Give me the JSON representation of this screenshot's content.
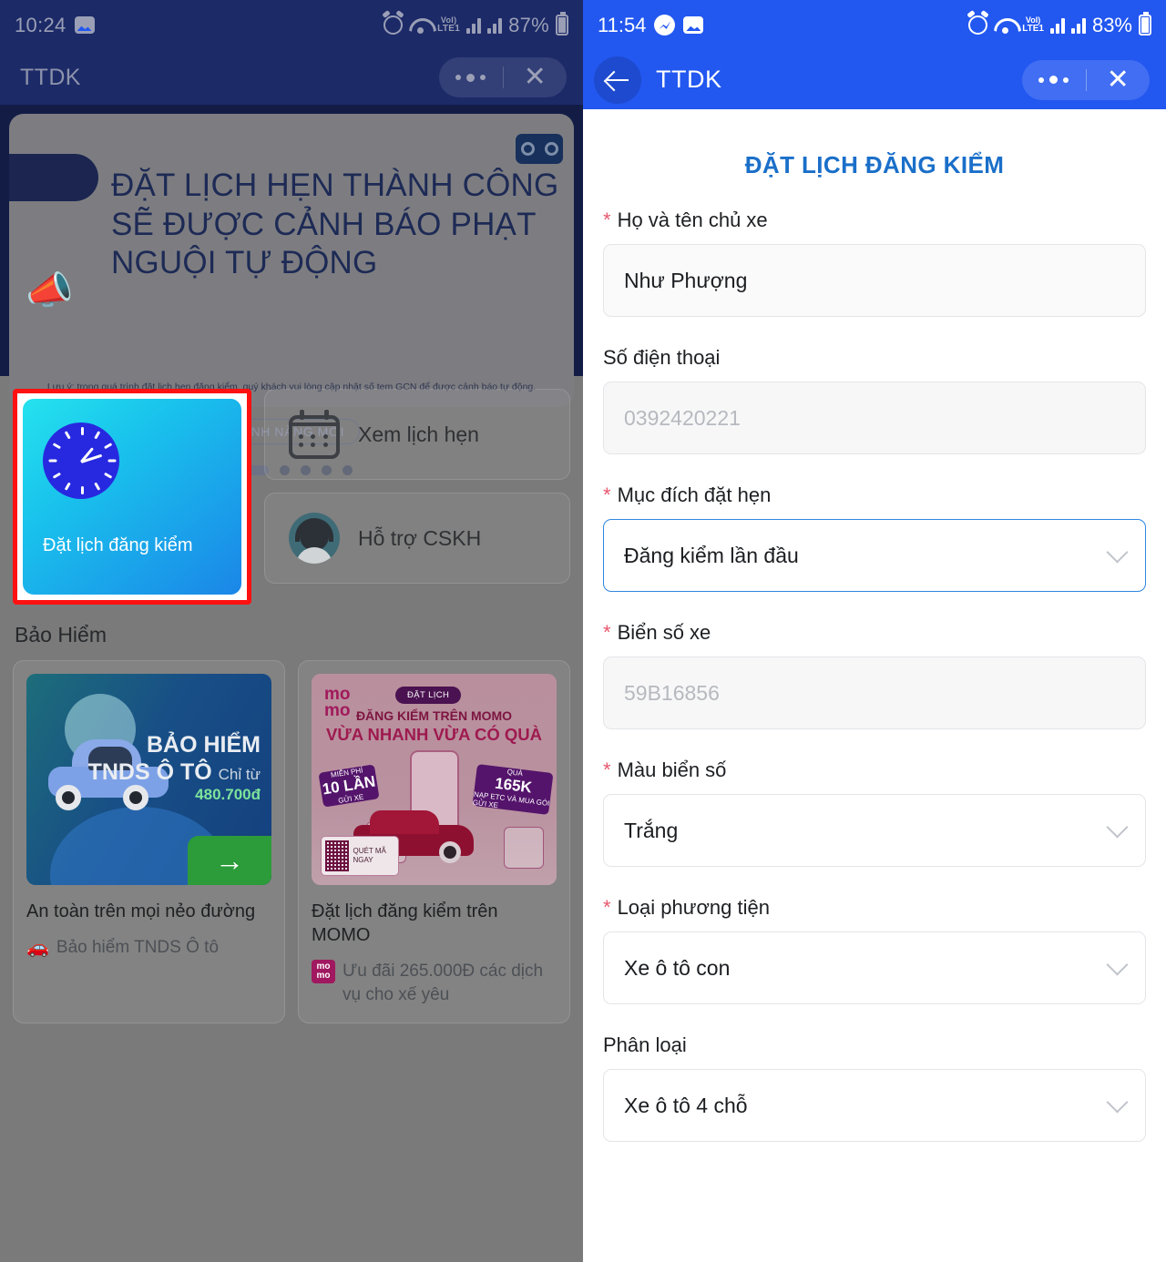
{
  "left": {
    "status": {
      "time": "10:24",
      "battery": "87%",
      "network": "LTE1",
      "volte": "VoI)"
    },
    "appbar": {
      "title": "TTDK"
    },
    "banner": {
      "title": "ĐẶT LỊCH HẸN THÀNH CÔNG SẼ ĐƯỢC CẢNH BÁO PHẠT NGUỘI TỰ ĐỘNG",
      "note": "Lưu ý: trong quá trình đặt lịch hẹn đăng kiểm, quý khách vui lòng cập nhật số tem GCN để được cảnh báo tự động.",
      "feature_chip": "TÍNH NĂNG MỚI",
      "dots_count": 5,
      "active_dot": 0
    },
    "tiles": {
      "primary": {
        "label": "Đặt lịch đăng kiểm",
        "highlight_color": "#ff1111"
      },
      "secondary": [
        {
          "label": "Xem lịch hẹn",
          "icon": "calendar-icon"
        },
        {
          "label": "Hỗ trợ CSKH",
          "icon": "headset-agent-icon"
        }
      ]
    },
    "section_title": "Bảo Hiểm",
    "cards": [
      {
        "banner_title_line1": "BẢO HIỂM",
        "banner_title_line2": "TNDS Ô TÔ",
        "banner_price_prefix": "Chỉ từ ",
        "banner_price": "480.700đ",
        "caption": "An toàn trên mọi nẻo đường",
        "subcaption": "Bảo hiểm TNDS Ô tô"
      },
      {
        "logo": "momo",
        "chip": "ĐẶT LỊCH",
        "headline1": "ĐĂNG KIỂM TRÊN MOMO",
        "headline2": "VỪA NHANH VỪA CÓ QUÀ",
        "ticket_left_l1": "MIỄN PHÍ",
        "ticket_left_l2": "10 LẦN",
        "ticket_left_l3": "GỬI XE",
        "ticket_right_l1": "QUÀ",
        "ticket_right_l2": "165K",
        "ticket_right_l3": "NẠP ETC VÀ MUA GÓI GỬI XE",
        "qr_text": "QUÉT MÃ NGAY",
        "caption": "Đặt lịch đăng kiểm trên MOMO",
        "subcaption": "Ưu đãi 265.000Đ các dịch vụ cho xế yêu"
      }
    ]
  },
  "right": {
    "status": {
      "time": "11:54",
      "battery": "83%",
      "network": "LTE1",
      "volte": "VoI)"
    },
    "appbar": {
      "title": "TTDK"
    },
    "form": {
      "title": "ĐẶT LỊCH ĐĂNG KIỂM",
      "accent": "#1a6fc9",
      "fields": [
        {
          "label": "Họ và tên chủ xe",
          "required": true,
          "type": "text",
          "value": "Như Phượng",
          "placeholder": ""
        },
        {
          "label": "Số điện thoại",
          "required": false,
          "type": "text",
          "value": "",
          "placeholder": "0392420221"
        },
        {
          "label": "Mục đích đặt hẹn",
          "required": true,
          "type": "select",
          "value": "Đăng kiểm lần đầu",
          "placeholder": "",
          "focused": true
        },
        {
          "label": "Biển số xe",
          "required": true,
          "type": "text",
          "value": "",
          "placeholder": "59B16856"
        },
        {
          "label": "Màu biển số",
          "required": true,
          "type": "select",
          "value": "Trắng",
          "placeholder": ""
        },
        {
          "label": "Loại phương tiện",
          "required": true,
          "type": "select",
          "value": "Xe ô tô con",
          "placeholder": ""
        },
        {
          "label": "Phân loại",
          "required": false,
          "type": "select",
          "value": "Xe ô tô 4 chỗ",
          "placeholder": ""
        }
      ]
    }
  }
}
